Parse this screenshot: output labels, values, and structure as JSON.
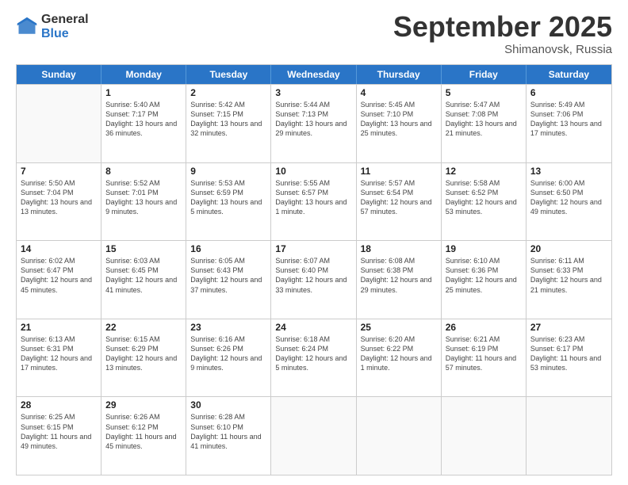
{
  "logo": {
    "line1": "General",
    "line2": "Blue"
  },
  "title": "September 2025",
  "subtitle": "Shimanovsk, Russia",
  "header_days": [
    "Sunday",
    "Monday",
    "Tuesday",
    "Wednesday",
    "Thursday",
    "Friday",
    "Saturday"
  ],
  "rows": [
    [
      {
        "day": "",
        "sunrise": "",
        "sunset": "",
        "daylight": ""
      },
      {
        "day": "1",
        "sunrise": "Sunrise: 5:40 AM",
        "sunset": "Sunset: 7:17 PM",
        "daylight": "Daylight: 13 hours and 36 minutes."
      },
      {
        "day": "2",
        "sunrise": "Sunrise: 5:42 AM",
        "sunset": "Sunset: 7:15 PM",
        "daylight": "Daylight: 13 hours and 32 minutes."
      },
      {
        "day": "3",
        "sunrise": "Sunrise: 5:44 AM",
        "sunset": "Sunset: 7:13 PM",
        "daylight": "Daylight: 13 hours and 29 minutes."
      },
      {
        "day": "4",
        "sunrise": "Sunrise: 5:45 AM",
        "sunset": "Sunset: 7:10 PM",
        "daylight": "Daylight: 13 hours and 25 minutes."
      },
      {
        "day": "5",
        "sunrise": "Sunrise: 5:47 AM",
        "sunset": "Sunset: 7:08 PM",
        "daylight": "Daylight: 13 hours and 21 minutes."
      },
      {
        "day": "6",
        "sunrise": "Sunrise: 5:49 AM",
        "sunset": "Sunset: 7:06 PM",
        "daylight": "Daylight: 13 hours and 17 minutes."
      }
    ],
    [
      {
        "day": "7",
        "sunrise": "Sunrise: 5:50 AM",
        "sunset": "Sunset: 7:04 PM",
        "daylight": "Daylight: 13 hours and 13 minutes."
      },
      {
        "day": "8",
        "sunrise": "Sunrise: 5:52 AM",
        "sunset": "Sunset: 7:01 PM",
        "daylight": "Daylight: 13 hours and 9 minutes."
      },
      {
        "day": "9",
        "sunrise": "Sunrise: 5:53 AM",
        "sunset": "Sunset: 6:59 PM",
        "daylight": "Daylight: 13 hours and 5 minutes."
      },
      {
        "day": "10",
        "sunrise": "Sunrise: 5:55 AM",
        "sunset": "Sunset: 6:57 PM",
        "daylight": "Daylight: 13 hours and 1 minute."
      },
      {
        "day": "11",
        "sunrise": "Sunrise: 5:57 AM",
        "sunset": "Sunset: 6:54 PM",
        "daylight": "Daylight: 12 hours and 57 minutes."
      },
      {
        "day": "12",
        "sunrise": "Sunrise: 5:58 AM",
        "sunset": "Sunset: 6:52 PM",
        "daylight": "Daylight: 12 hours and 53 minutes."
      },
      {
        "day": "13",
        "sunrise": "Sunrise: 6:00 AM",
        "sunset": "Sunset: 6:50 PM",
        "daylight": "Daylight: 12 hours and 49 minutes."
      }
    ],
    [
      {
        "day": "14",
        "sunrise": "Sunrise: 6:02 AM",
        "sunset": "Sunset: 6:47 PM",
        "daylight": "Daylight: 12 hours and 45 minutes."
      },
      {
        "day": "15",
        "sunrise": "Sunrise: 6:03 AM",
        "sunset": "Sunset: 6:45 PM",
        "daylight": "Daylight: 12 hours and 41 minutes."
      },
      {
        "day": "16",
        "sunrise": "Sunrise: 6:05 AM",
        "sunset": "Sunset: 6:43 PM",
        "daylight": "Daylight: 12 hours and 37 minutes."
      },
      {
        "day": "17",
        "sunrise": "Sunrise: 6:07 AM",
        "sunset": "Sunset: 6:40 PM",
        "daylight": "Daylight: 12 hours and 33 minutes."
      },
      {
        "day": "18",
        "sunrise": "Sunrise: 6:08 AM",
        "sunset": "Sunset: 6:38 PM",
        "daylight": "Daylight: 12 hours and 29 minutes."
      },
      {
        "day": "19",
        "sunrise": "Sunrise: 6:10 AM",
        "sunset": "Sunset: 6:36 PM",
        "daylight": "Daylight: 12 hours and 25 minutes."
      },
      {
        "day": "20",
        "sunrise": "Sunrise: 6:11 AM",
        "sunset": "Sunset: 6:33 PM",
        "daylight": "Daylight: 12 hours and 21 minutes."
      }
    ],
    [
      {
        "day": "21",
        "sunrise": "Sunrise: 6:13 AM",
        "sunset": "Sunset: 6:31 PM",
        "daylight": "Daylight: 12 hours and 17 minutes."
      },
      {
        "day": "22",
        "sunrise": "Sunrise: 6:15 AM",
        "sunset": "Sunset: 6:29 PM",
        "daylight": "Daylight: 12 hours and 13 minutes."
      },
      {
        "day": "23",
        "sunrise": "Sunrise: 6:16 AM",
        "sunset": "Sunset: 6:26 PM",
        "daylight": "Daylight: 12 hours and 9 minutes."
      },
      {
        "day": "24",
        "sunrise": "Sunrise: 6:18 AM",
        "sunset": "Sunset: 6:24 PM",
        "daylight": "Daylight: 12 hours and 5 minutes."
      },
      {
        "day": "25",
        "sunrise": "Sunrise: 6:20 AM",
        "sunset": "Sunset: 6:22 PM",
        "daylight": "Daylight: 12 hours and 1 minute."
      },
      {
        "day": "26",
        "sunrise": "Sunrise: 6:21 AM",
        "sunset": "Sunset: 6:19 PM",
        "daylight": "Daylight: 11 hours and 57 minutes."
      },
      {
        "day": "27",
        "sunrise": "Sunrise: 6:23 AM",
        "sunset": "Sunset: 6:17 PM",
        "daylight": "Daylight: 11 hours and 53 minutes."
      }
    ],
    [
      {
        "day": "28",
        "sunrise": "Sunrise: 6:25 AM",
        "sunset": "Sunset: 6:15 PM",
        "daylight": "Daylight: 11 hours and 49 minutes."
      },
      {
        "day": "29",
        "sunrise": "Sunrise: 6:26 AM",
        "sunset": "Sunset: 6:12 PM",
        "daylight": "Daylight: 11 hours and 45 minutes."
      },
      {
        "day": "30",
        "sunrise": "Sunrise: 6:28 AM",
        "sunset": "Sunset: 6:10 PM",
        "daylight": "Daylight: 11 hours and 41 minutes."
      },
      {
        "day": "",
        "sunrise": "",
        "sunset": "",
        "daylight": ""
      },
      {
        "day": "",
        "sunrise": "",
        "sunset": "",
        "daylight": ""
      },
      {
        "day": "",
        "sunrise": "",
        "sunset": "",
        "daylight": ""
      },
      {
        "day": "",
        "sunrise": "",
        "sunset": "",
        "daylight": ""
      }
    ]
  ]
}
